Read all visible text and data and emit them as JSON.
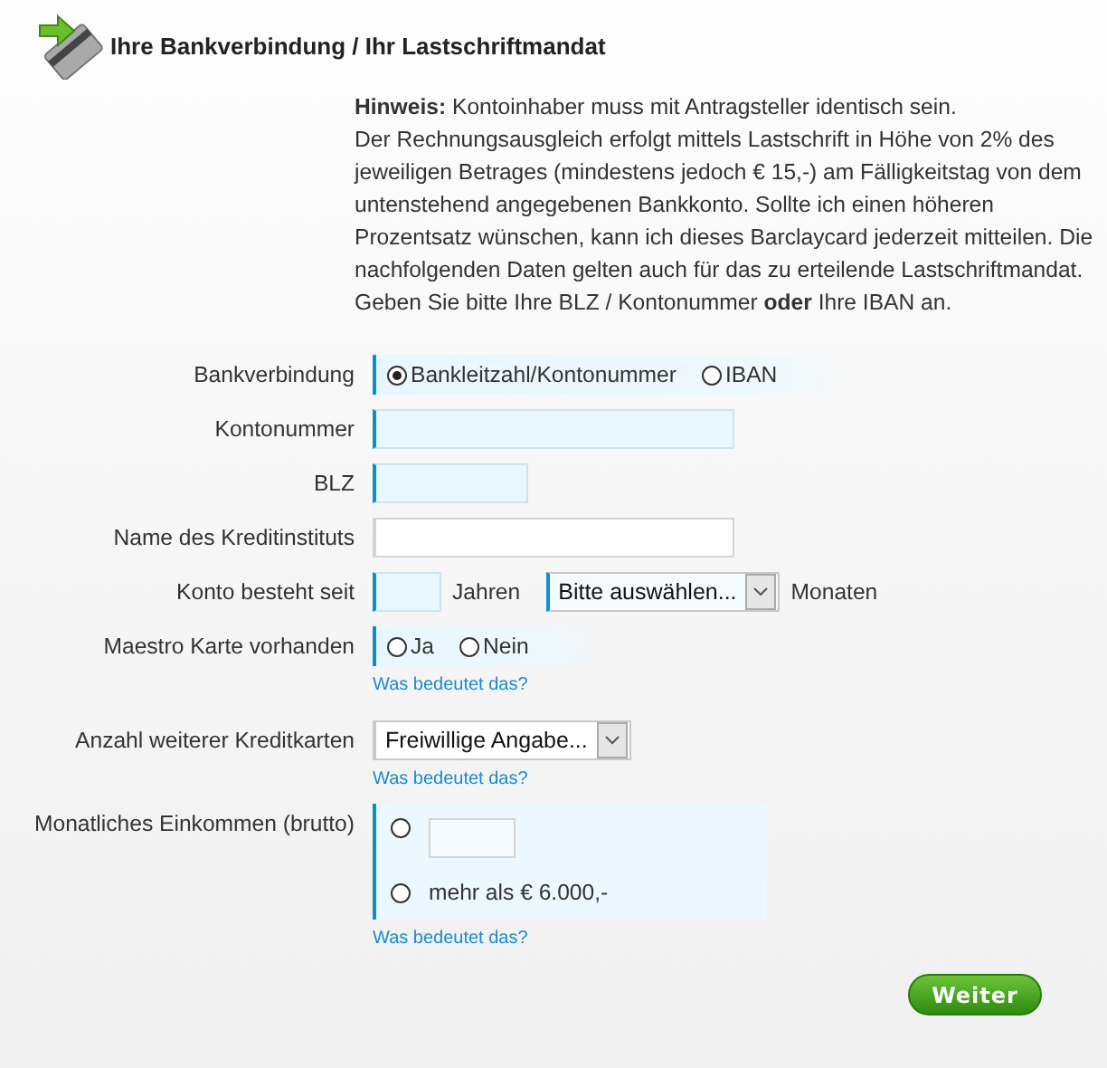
{
  "header": {
    "title": "Ihre Bankverbindung / Ihr Lastschriftmandat"
  },
  "notice": {
    "lines": [
      "**Hinweis:** Kontoinhaber muss mit Antragsteller identisch sein.",
      "Der Rechnungsausgleich erfolgt mittels Lastschrift in Höhe von 2% des",
      "jeweiligen Betrages (mindestens jedoch € 15,-) am Fälligkeitstag von dem",
      "untenstehend angegebenen Bankkonto. Sollte ich einen höheren",
      "Prozentsatz wünschen, kann ich dieses Barclaycard jederzeit mitteilen. Die",
      "nachfolgenden Daten gelten auch für das zu erteilende Lastschriftmandat.",
      "Geben Sie bitte Ihre BLZ / Kontonummer **oder** Ihre IBAN an."
    ]
  },
  "rows": [
    {
      "kind": "radio",
      "label": "Bankverbindung",
      "highlighted": true,
      "options": [
        {
          "label": "Bankleitzahl/Kontonummer",
          "selected": true
        },
        {
          "label": "IBAN",
          "selected": false
        }
      ]
    },
    {
      "kind": "text",
      "label": "Kontonummer",
      "highlighted": true
    },
    {
      "kind": "short_text",
      "label": "BLZ",
      "highlighted": true
    },
    {
      "kind": "text",
      "label": "Name des Kreditinstituts",
      "highlighted": false
    },
    {
      "kind": "duration",
      "label": "Konto besteht seit",
      "highlighted": true,
      "years_unit": "Jahren",
      "select_value": "Bitte auswählen...",
      "months_unit": "Monaten"
    },
    {
      "kind": "radio",
      "label": "Maestro Karte vorhanden",
      "highlighted": true,
      "options": [
        {
          "label": "Ja",
          "selected": false
        },
        {
          "label": "Nein",
          "selected": false
        }
      ],
      "help": "Was bedeutet das?"
    },
    {
      "kind": "select",
      "label": "Anzahl weiterer Kreditkarten",
      "highlighted": false,
      "value": "Freiwillige Angabe...",
      "help": "Was bedeutet das?"
    },
    {
      "kind": "income",
      "label": "Monatliches Einkommen (brutto)",
      "highlighted": true,
      "options": [
        {
          "selected": false
        },
        {
          "label": "mehr als € 6.000,-",
          "selected": false
        }
      ],
      "help": "Was bedeutet das?"
    }
  ],
  "submit": {
    "label": "Weiter"
  }
}
